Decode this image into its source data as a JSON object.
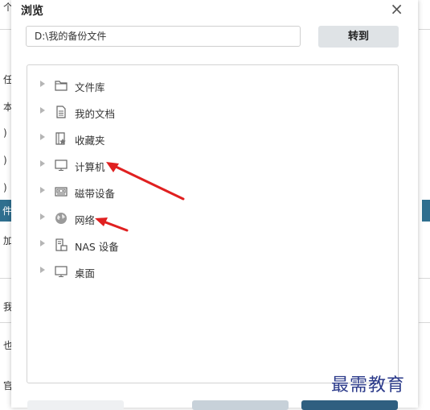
{
  "dialog": {
    "title": "浏览",
    "close_glyph": "×",
    "path_value": "D:\\我的备份文件",
    "goto_label": "转到"
  },
  "tree": {
    "items": [
      {
        "label": "文件库",
        "icon": "folder-icon"
      },
      {
        "label": "我的文档",
        "icon": "document-icon"
      },
      {
        "label": "收藏夹",
        "icon": "favorites-icon"
      },
      {
        "label": "计算机",
        "icon": "computer-icon"
      },
      {
        "label": "磁带设备",
        "icon": "tape-device-icon"
      },
      {
        "label": "网络",
        "icon": "network-globe-icon"
      },
      {
        "label": "NAS 设备",
        "icon": "nas-device-icon"
      },
      {
        "label": "桌面",
        "icon": "desktop-icon"
      }
    ]
  },
  "background": {
    "fragments": [
      "个",
      "任",
      "本",
      ")",
      ")",
      ")",
      "件",
      "加",
      "我",
      "也",
      "官"
    ]
  },
  "watermark": "最需教育",
  "colors": {
    "arrow": "#e02020",
    "accent_blue": "#2f6f8f",
    "goto_bg": "#dfe3e6"
  }
}
